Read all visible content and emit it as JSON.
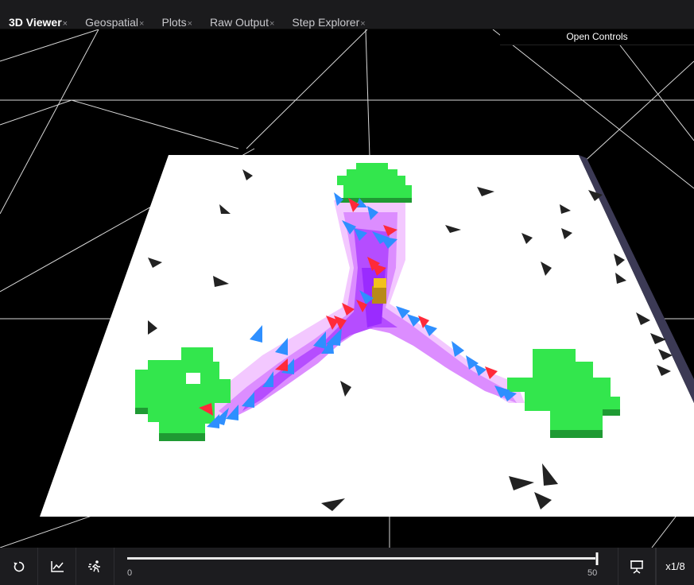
{
  "tabs": [
    {
      "label": "3D Viewer",
      "close": "×",
      "active": true
    },
    {
      "label": "Geospatial",
      "close": "×"
    },
    {
      "label": "Plots",
      "close": "×"
    },
    {
      "label": "Raw Output",
      "close": "×"
    },
    {
      "label": "Step Explorer",
      "close": "×"
    }
  ],
  "viewport": {
    "open_controls_label": "Open Controls",
    "colors": {
      "floor": "#ffffff",
      "nest": "#33e64d",
      "trail": "#b84dff",
      "agent_red": "#ff2a3a",
      "agent_blue": "#2e8fff",
      "obstacle": "#222222",
      "food": "#e8b81e"
    }
  },
  "playback": {
    "min_label": "0",
    "max_label": "50",
    "progress": 1.0,
    "speed_label": "x1/8"
  },
  "toolbar": {
    "reset_icon": "reset-icon",
    "plot_icon": "chart-icon",
    "run_icon": "run-icon",
    "present_icon": "presentation-icon"
  }
}
